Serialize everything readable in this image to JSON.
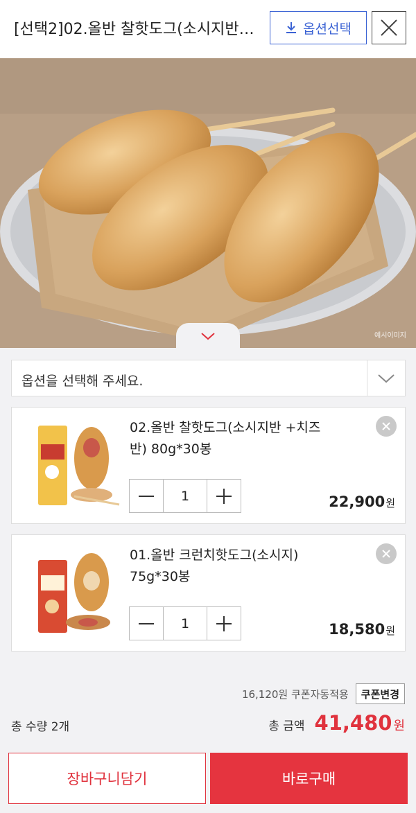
{
  "header": {
    "title": "[선택2]02.올반 찰핫도그(소시지반…",
    "option_button_label": "옵션선택"
  },
  "photo": {
    "note": "예시이미지"
  },
  "option_select": {
    "placeholder": "옵션을 선택해 주세요."
  },
  "items": [
    {
      "name": "02.올반 찰핫도그(소시지반 +치즈반) 80g*30봉",
      "quantity": "1",
      "price": "22,900",
      "currency": "원"
    },
    {
      "name": "01.올반 크런치핫도그(소시지) 75g*30봉",
      "quantity": "1",
      "price": "18,580",
      "currency": "원"
    }
  ],
  "coupon": {
    "text": "16,120원 쿠폰자동적용",
    "button_label": "쿠폰변경"
  },
  "summary": {
    "qty_text": "총 수량 2개",
    "amount_label": "총 금액",
    "amount_value": "41,480",
    "amount_currency": "원"
  },
  "actions": {
    "cart_label": "장바구니담기",
    "buy_label": "바로구매"
  },
  "colors": {
    "accent_red": "#e0323d",
    "accent_blue": "#3b63d4"
  }
}
